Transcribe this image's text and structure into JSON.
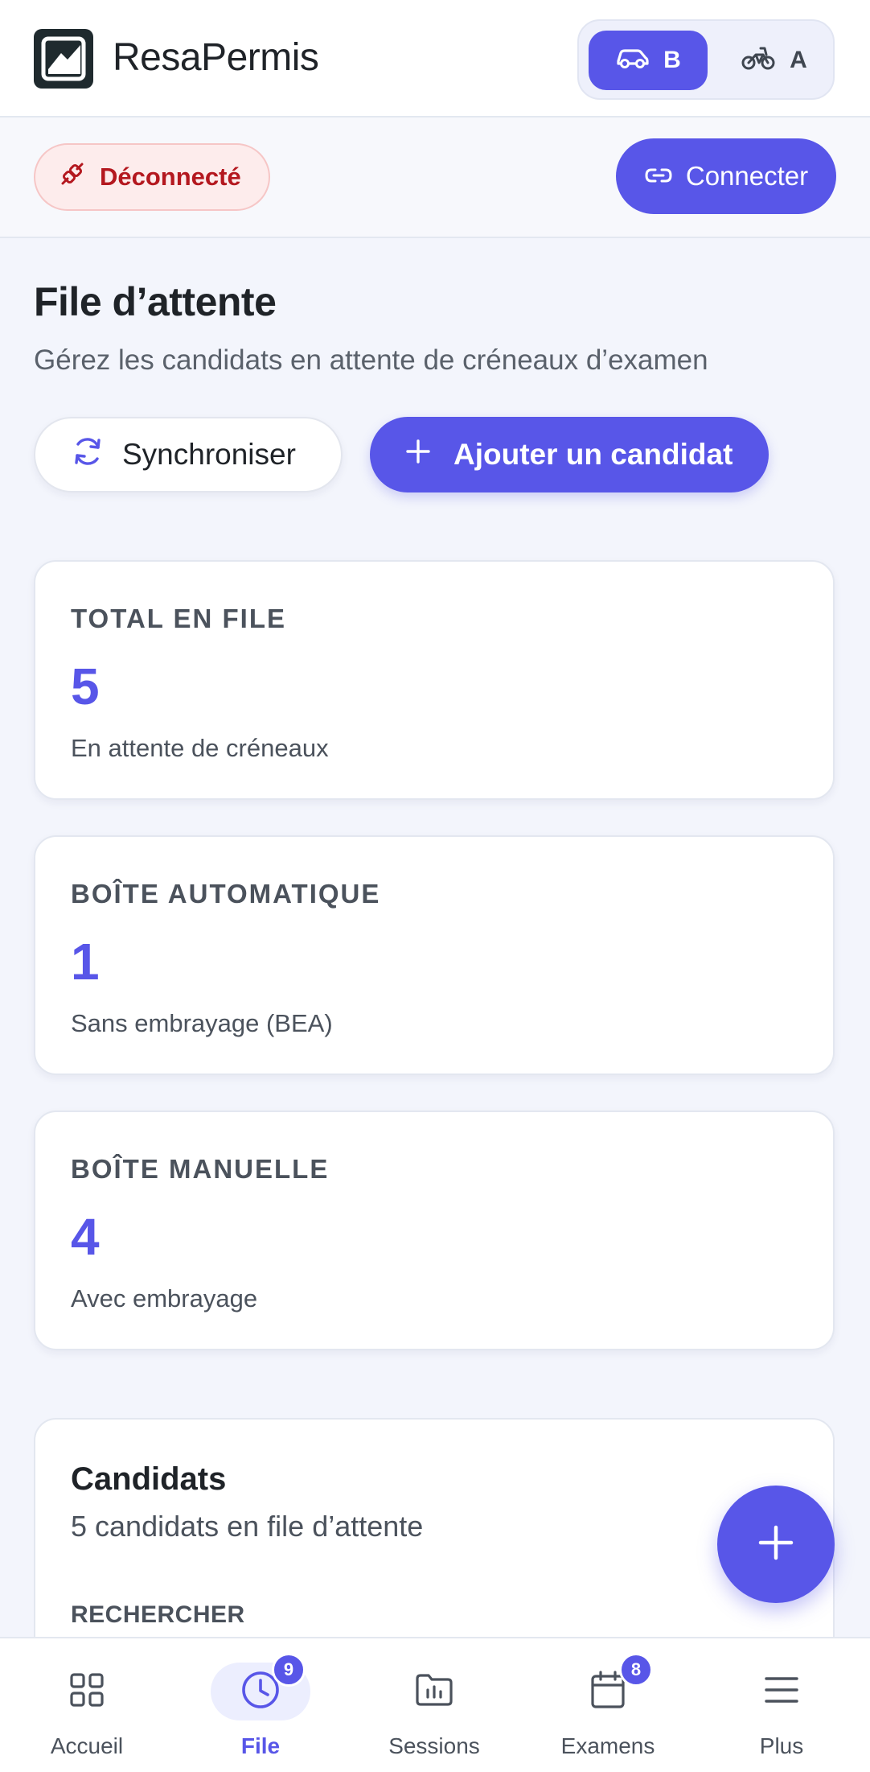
{
  "app": {
    "name": "ResaPermis",
    "mode_b_label": "B",
    "mode_a_label": "A"
  },
  "status": {
    "connection_label": "Déconnecté",
    "connect_button": "Connecter"
  },
  "page": {
    "title": "File d’attente",
    "subtitle": "Gérez les candidats en attente de créneaux d’examen",
    "sync_button": "Synchroniser",
    "add_button": "Ajouter un candidat"
  },
  "stats": [
    {
      "label": "TOTAL EN FILE",
      "value": "5",
      "caption": "En attente de créneaux"
    },
    {
      "label": "BOÎTE AUTOMATIQUE",
      "value": "1",
      "caption": "Sans embrayage (BEA)"
    },
    {
      "label": "BOÎTE MANUELLE",
      "value": "4",
      "caption": "Avec embrayage"
    }
  ],
  "candidates": {
    "title": "Candidats",
    "subtitle": "5 candidats en file d’attente",
    "search_label": "RECHERCHER"
  },
  "nav": {
    "items": [
      {
        "label": "Accueil",
        "icon": "grid-icon",
        "active": false
      },
      {
        "label": "File",
        "icon": "clock-icon",
        "active": true,
        "badge": "9"
      },
      {
        "label": "Sessions",
        "icon": "folder-chart-icon",
        "active": false
      },
      {
        "label": "Examens",
        "icon": "calendar-icon",
        "active": false,
        "badge": "8"
      },
      {
        "label": "Plus",
        "icon": "menu-icon",
        "active": false
      }
    ]
  },
  "colors": {
    "accent": "#5856e8",
    "danger": "#b4181f",
    "background": "#f3f5fc"
  }
}
